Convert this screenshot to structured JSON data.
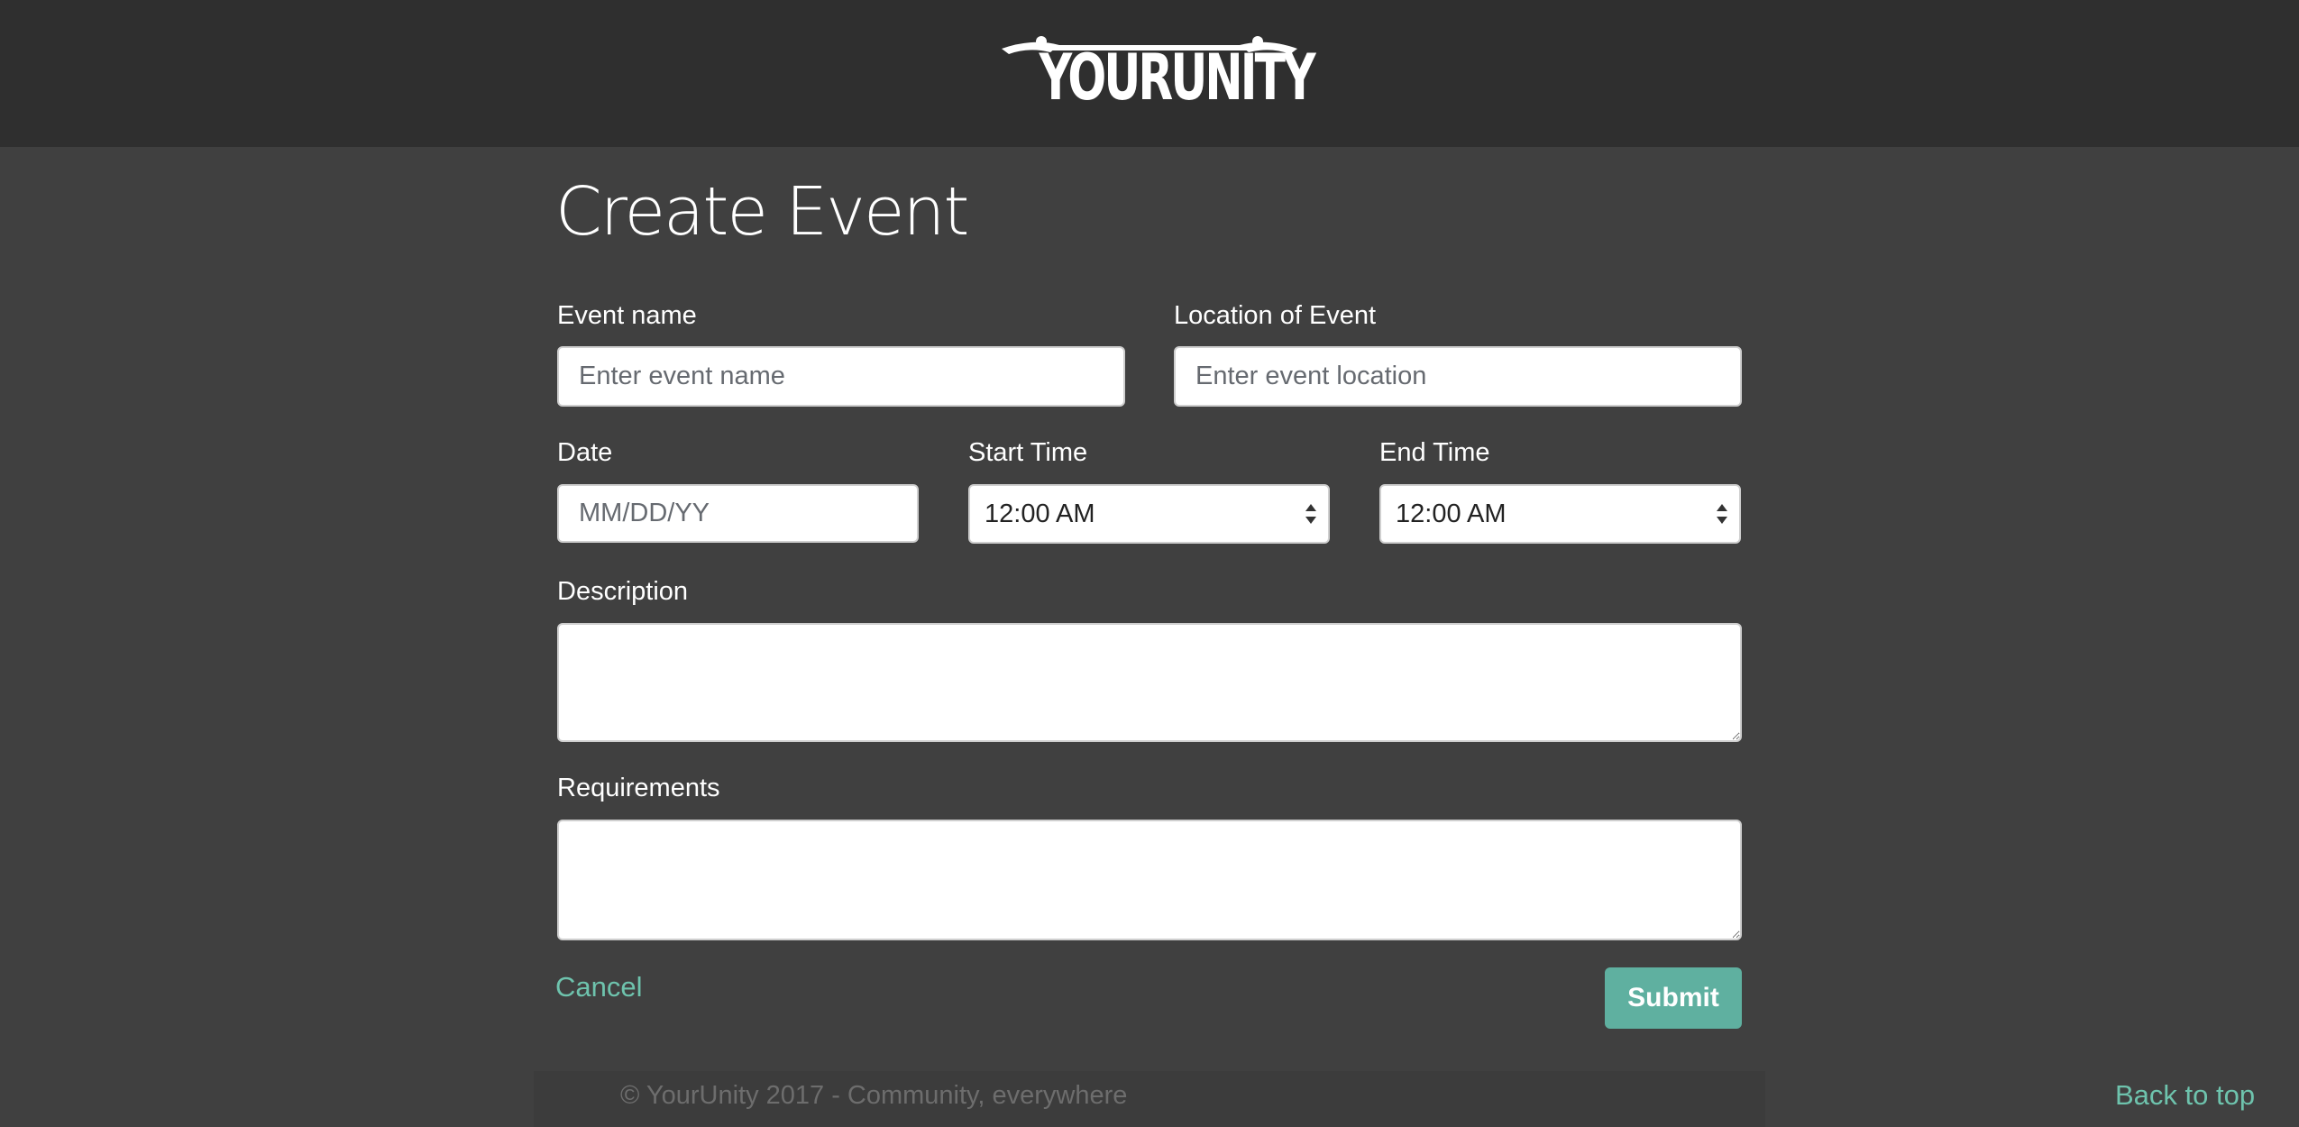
{
  "header": {
    "logo_text": "YOURUNITY"
  },
  "page": {
    "title": "Create Event"
  },
  "form": {
    "event_name": {
      "label": "Event name",
      "placeholder": "Enter event name",
      "value": ""
    },
    "location": {
      "label": "Location of Event",
      "placeholder": "Enter event location",
      "value": ""
    },
    "date": {
      "label": "Date",
      "placeholder": "MM/DD/YY",
      "value": ""
    },
    "start_time": {
      "label": "Start Time",
      "selected": "12:00 AM"
    },
    "end_time": {
      "label": "End Time",
      "selected": "12:00 AM"
    },
    "description": {
      "label": "Description",
      "value": ""
    },
    "requirements": {
      "label": "Requirements",
      "value": ""
    },
    "cancel_label": "Cancel",
    "submit_label": "Submit"
  },
  "footer": {
    "copyright": "© YourUnity 2017 - Community, everywhere",
    "back_to_top": "Back to top"
  },
  "colors": {
    "header_bg": "#2f2f2f",
    "page_bg": "#404040",
    "accent": "#6ec3ad",
    "submit_bg": "#5fb0a0"
  },
  "icons": {
    "logo": "yourunity-logo",
    "select_arrows": "updown-chevrons-icon"
  }
}
